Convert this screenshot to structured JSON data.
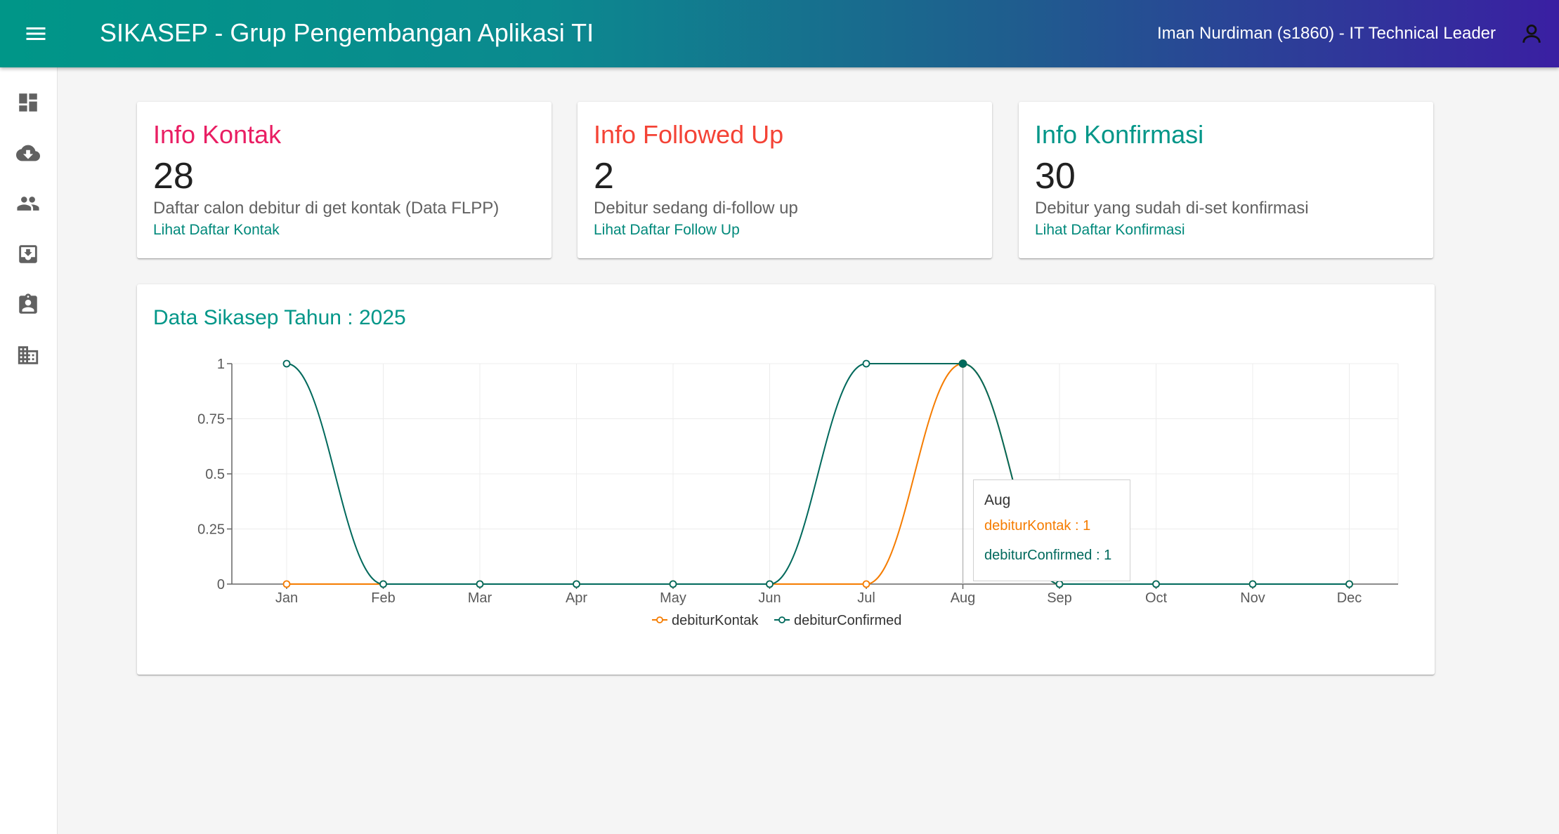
{
  "header": {
    "title": "SIKASEP - Grup Pengembangan Aplikasi TI",
    "user": "Iman Nurdiman (s1860) - IT Technical Leader",
    "menu_icon": "menu-icon",
    "user_icon": "account-icon"
  },
  "sidebar": {
    "items": [
      {
        "icon": "dashboard-icon"
      },
      {
        "icon": "cloud-download-icon"
      },
      {
        "icon": "people-icon"
      },
      {
        "icon": "inbox-icon"
      },
      {
        "icon": "assignment-ind-icon"
      },
      {
        "icon": "business-icon"
      }
    ]
  },
  "cards": [
    {
      "title": "Info Kontak",
      "count": "28",
      "description": "Daftar calon debitur di get kontak (Data FLPP)",
      "link": "Lihat Daftar Kontak",
      "color": "#e91e63"
    },
    {
      "title": "Info Followed Up",
      "count": "2",
      "description": "Debitur sedang di-follow up",
      "link": "Lihat Daftar Follow Up",
      "color": "#f44336"
    },
    {
      "title": "Info Konfirmasi",
      "count": "30",
      "description": "Debitur yang sudah di-set konfirmasi",
      "link": "Lihat Daftar Konfirmasi",
      "color": "#009688"
    }
  ],
  "chart_section": {
    "title": "Data Sikasep Tahun : 2025"
  },
  "tooltip": {
    "title": "Aug",
    "rows": [
      "debiturKontak : 1",
      "debiturConfirmed : 1"
    ]
  },
  "colors": {
    "kontak": "#f57c00",
    "confirmed": "#00695c",
    "accent": "#009688"
  },
  "chart_data": {
    "type": "line",
    "categories": [
      "Jan",
      "Feb",
      "Mar",
      "Apr",
      "May",
      "Jun",
      "Jul",
      "Aug",
      "Sep",
      "Oct",
      "Nov",
      "Dec"
    ],
    "series": [
      {
        "name": "debiturKontak",
        "values": [
          0,
          0,
          0,
          0,
          0,
          0,
          0,
          1,
          0,
          0,
          0,
          0
        ],
        "color": "#f57c00"
      },
      {
        "name": "debiturConfirmed",
        "values": [
          1,
          0,
          0,
          0,
          0,
          0,
          1,
          1,
          0,
          0,
          0,
          0
        ],
        "color": "#00695c"
      }
    ],
    "yticks": [
      "0",
      "0.25",
      "0.5",
      "0.75",
      "1"
    ],
    "ylim": [
      0,
      1
    ],
    "grid": true,
    "legend": "bottom-center"
  }
}
